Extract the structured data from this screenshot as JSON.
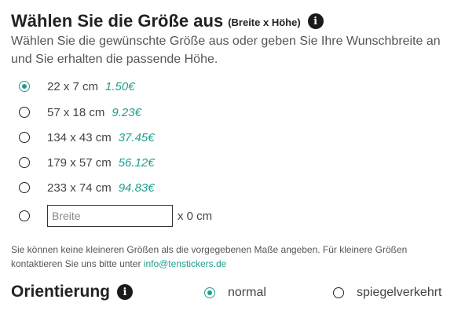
{
  "size_section": {
    "title": "Wählen Sie die Größe aus",
    "subtitle": "(Breite x Höhe)",
    "info_icon": "info-icon",
    "description": "Wählen Sie die gewünschte Größe aus oder geben Sie Ihre Wunschbreite an und Sie erhalten die passende Höhe.",
    "options": [
      {
        "label": "22 x 7 cm",
        "price": "1.50€",
        "selected": true
      },
      {
        "label": "57 x 18 cm",
        "price": "9.23€",
        "selected": false
      },
      {
        "label": "134 x 43 cm",
        "price": "37.45€",
        "selected": false
      },
      {
        "label": "179 x 57 cm",
        "price": "56.12€",
        "selected": false
      },
      {
        "label": "233 x 74 cm",
        "price": "94.83€",
        "selected": false
      }
    ],
    "custom": {
      "placeholder": "Breite",
      "value": "",
      "suffix": "x 0 cm",
      "selected": false
    },
    "note_text": "Sie können keine kleineren Größen als die vorgegebenen Maße angeben. Für kleinere Größen kontaktieren Sie uns bitte unter ",
    "note_email": "info@tenstickers.de"
  },
  "orientation_section": {
    "title": "Orientierung",
    "info_icon": "info-icon",
    "options": [
      {
        "label": "normal",
        "selected": true
      },
      {
        "label": "spiegelverkehrt",
        "selected": false
      }
    ]
  },
  "colors": {
    "accent": "#1f9e8c",
    "text": "#333333",
    "heading": "#222222"
  }
}
